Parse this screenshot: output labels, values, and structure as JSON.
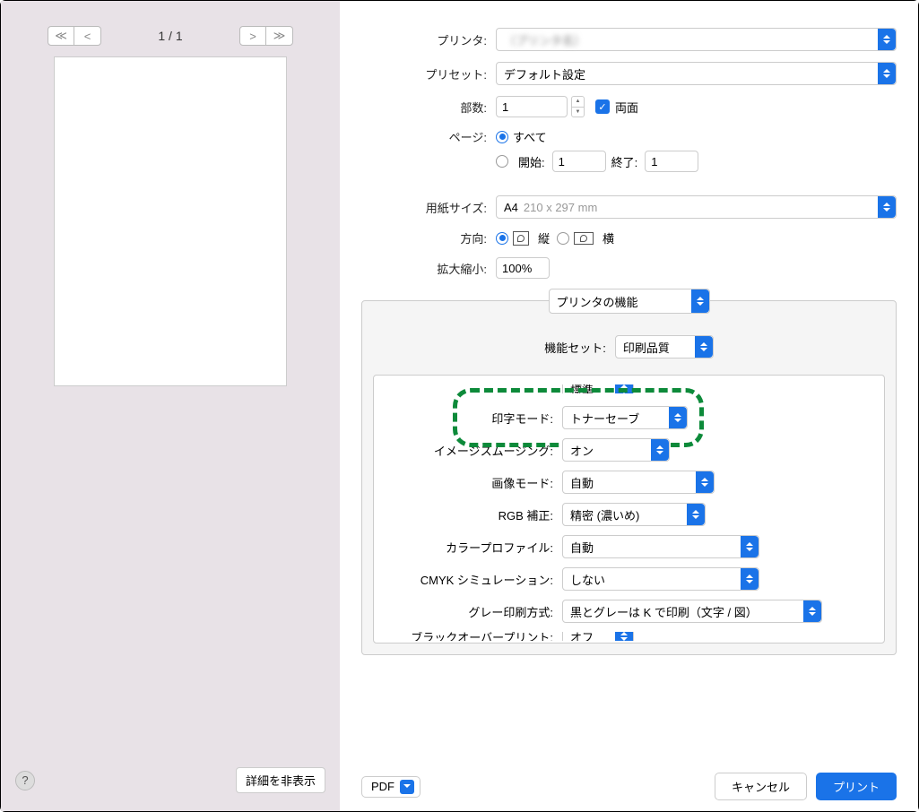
{
  "preview": {
    "page_indicator": "1 / 1",
    "hide_details": "詳細を非表示"
  },
  "labels": {
    "printer": "プリンタ:",
    "preset": "プリセット:",
    "copies": "部数:",
    "duplex": "両面",
    "pages": "ページ:",
    "pages_all": "すべて",
    "pages_range": "開始:",
    "pages_to": "終了:",
    "paper_size": "用紙サイズ:",
    "orientation": "方向:",
    "portrait": "縦",
    "landscape": "横",
    "scale": "拡大縮小:",
    "features_tab": "プリンタの機能",
    "feature_set": "機能セット:",
    "print_mode": "印字モード:",
    "image_smoothing": "イメージスムージング:",
    "image_mode": "画像モード:",
    "rgb_correction": "RGB 補正:",
    "color_profile": "カラープロファイル:",
    "cmyk_sim": "CMYK シミュレーション:",
    "gray_print": "グレー印刷方式:",
    "black_overprint": "ブラックオーバープリント:"
  },
  "values": {
    "printer_name": "（プリンタ名）",
    "preset": "デフォルト設定",
    "copies": "1",
    "from": "1",
    "to": "1",
    "paper_size": "A4",
    "paper_dims": "210 x 297 mm",
    "scale": "100%",
    "feature_set": "印刷品質",
    "tone_mode_top": "標準",
    "print_mode": "トナーセーブ",
    "image_smoothing": "オン",
    "image_mode": "自動",
    "rgb_correction": "精密 (濃いめ)",
    "color_profile": "自動",
    "cmyk_sim": "しない",
    "gray_print": "黒とグレーは K で印刷（文字 / 図）",
    "black_overprint": "オフ"
  },
  "buttons": {
    "pdf": "PDF",
    "cancel": "キャンセル",
    "print": "プリント"
  }
}
